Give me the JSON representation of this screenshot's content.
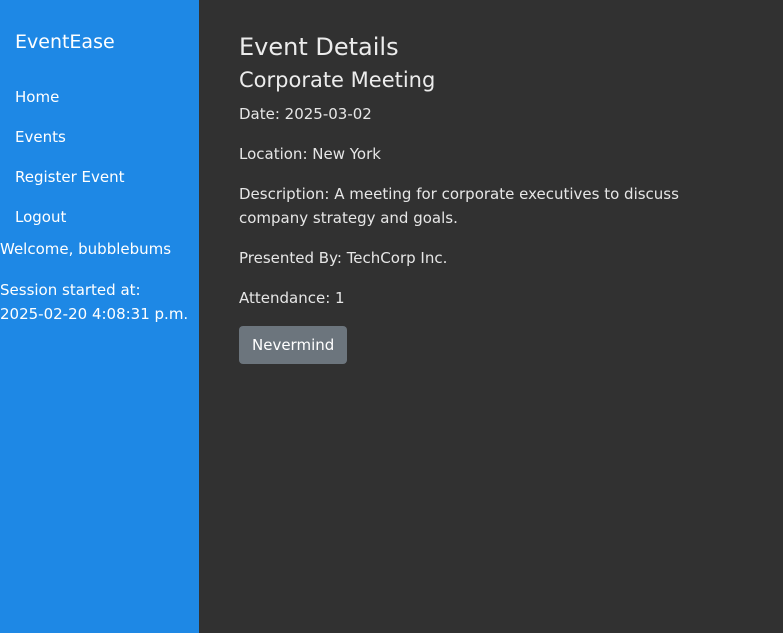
{
  "sidebar": {
    "brand": "EventEase",
    "nav": [
      {
        "label": "Home"
      },
      {
        "label": "Events"
      },
      {
        "label": "Register Event"
      },
      {
        "label": "Logout"
      }
    ],
    "welcome": "Welcome, bubblebums",
    "session_label": "Session started at:",
    "session_time": "2025-02-20 4:08:31 p.m."
  },
  "main": {
    "page_title": "Event Details",
    "event_name": "Corporate Meeting",
    "date": "Date: 2025-03-02",
    "location": "Location: New York",
    "description": "Description: A meeting for corporate executives to discuss company strategy and goals.",
    "presenter": "Presented By: TechCorp Inc.",
    "attendance": "Attendance: 1",
    "button_label": "Nevermind"
  },
  "colors": {
    "sidebar_bg": "#1e88e5",
    "main_bg": "#313131",
    "button_bg": "#6c757d"
  }
}
